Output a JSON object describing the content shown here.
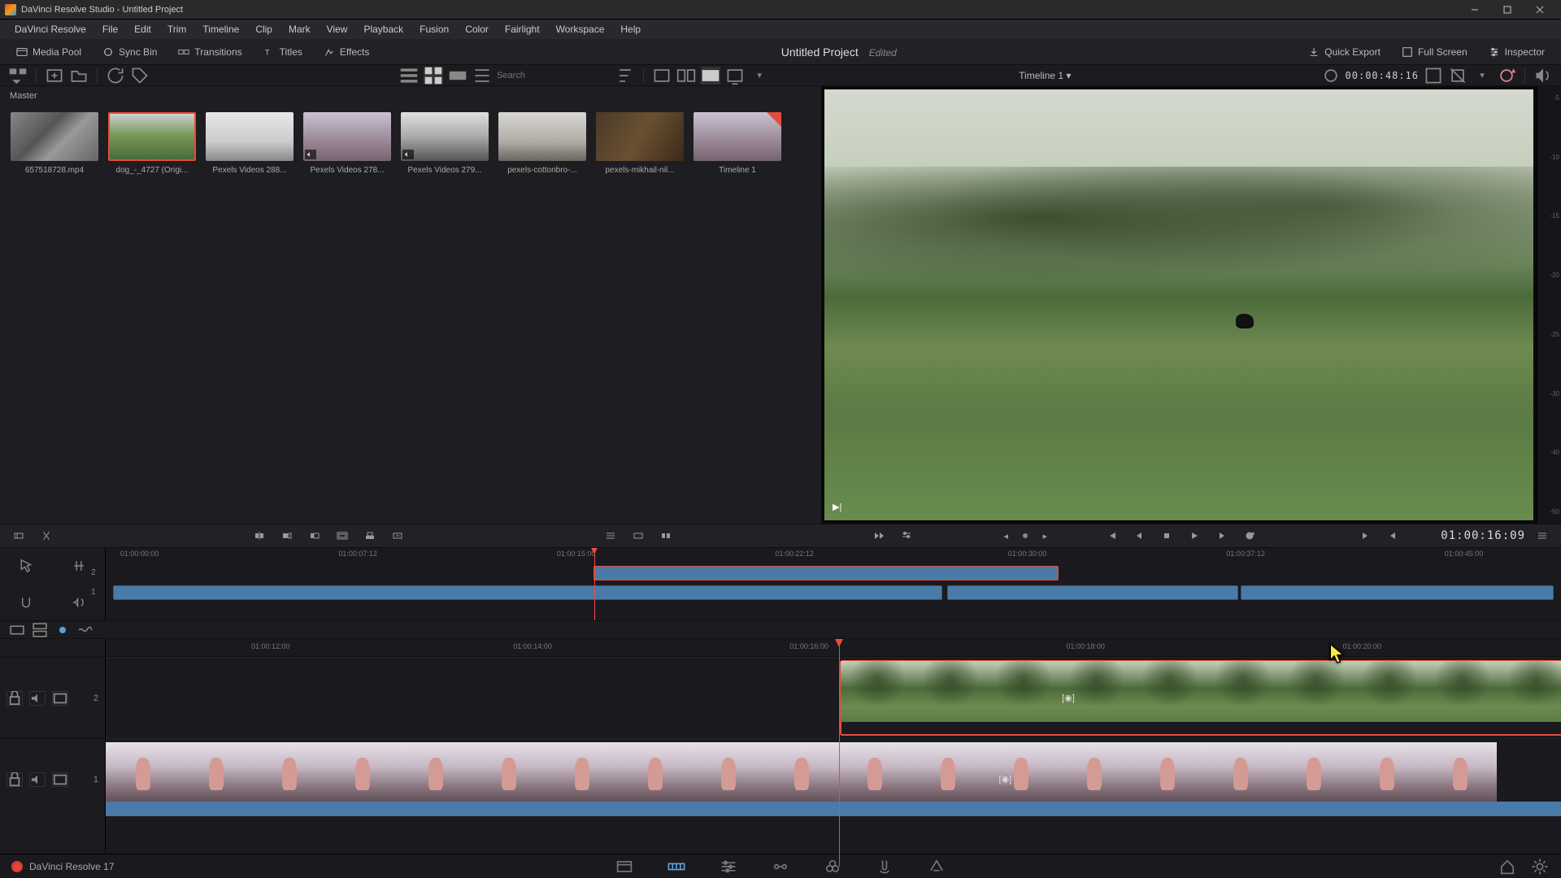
{
  "window": {
    "title": "DaVinci Resolve Studio - Untitled Project"
  },
  "menu": [
    "DaVinci Resolve",
    "File",
    "Edit",
    "Trim",
    "Timeline",
    "Clip",
    "Mark",
    "View",
    "Playback",
    "Fusion",
    "Color",
    "Fairlight",
    "Workspace",
    "Help"
  ],
  "toolbar": {
    "media_pool": "Media Pool",
    "sync_bin": "Sync Bin",
    "transitions": "Transitions",
    "titles": "Titles",
    "effects": "Effects",
    "quick_export": "Quick Export",
    "full_screen": "Full Screen",
    "inspector": "Inspector",
    "project_title": "Untitled Project",
    "project_status": "Edited"
  },
  "subbar": {
    "search_placeholder": "Search",
    "timeline_name": "Timeline 1",
    "duration_tc": "00:00:48:16"
  },
  "media": {
    "master": "Master",
    "clips": [
      {
        "label": "657518728.mp4"
      },
      {
        "label": "dog_-_4727 (Origi..."
      },
      {
        "label": "Pexels Videos 288..."
      },
      {
        "label": "Pexels Videos 278..."
      },
      {
        "label": "Pexels Videos 279..."
      },
      {
        "label": "pexels-cottonbro-..."
      },
      {
        "label": "pexels-mikhail-nil..."
      },
      {
        "label": "Timeline 1"
      }
    ]
  },
  "transport": {
    "current_tc": "01:00:16:09"
  },
  "ruler_overview": [
    "01:00:00:00",
    "01:00:07:12",
    "01:00:15:00",
    "01:00:22:12",
    "01:00:30:00",
    "01:00:37:12",
    "01:00:45:00"
  ],
  "ruler_detail": [
    "01:00:12:00",
    "01:00:14:00",
    "01:00:16:00",
    "01:00:18:00",
    "01:00:20:00"
  ],
  "overview_tracks": {
    "t2": "2",
    "t1": "1"
  },
  "detail_tracks": {
    "t2": "2",
    "t1": "1"
  },
  "audio_meter_scale": [
    "-5",
    "-10",
    "-15",
    "-20",
    "-25",
    "-30",
    "-40",
    "-50"
  ],
  "bottom": {
    "version": "DaVinci Resolve 17"
  }
}
